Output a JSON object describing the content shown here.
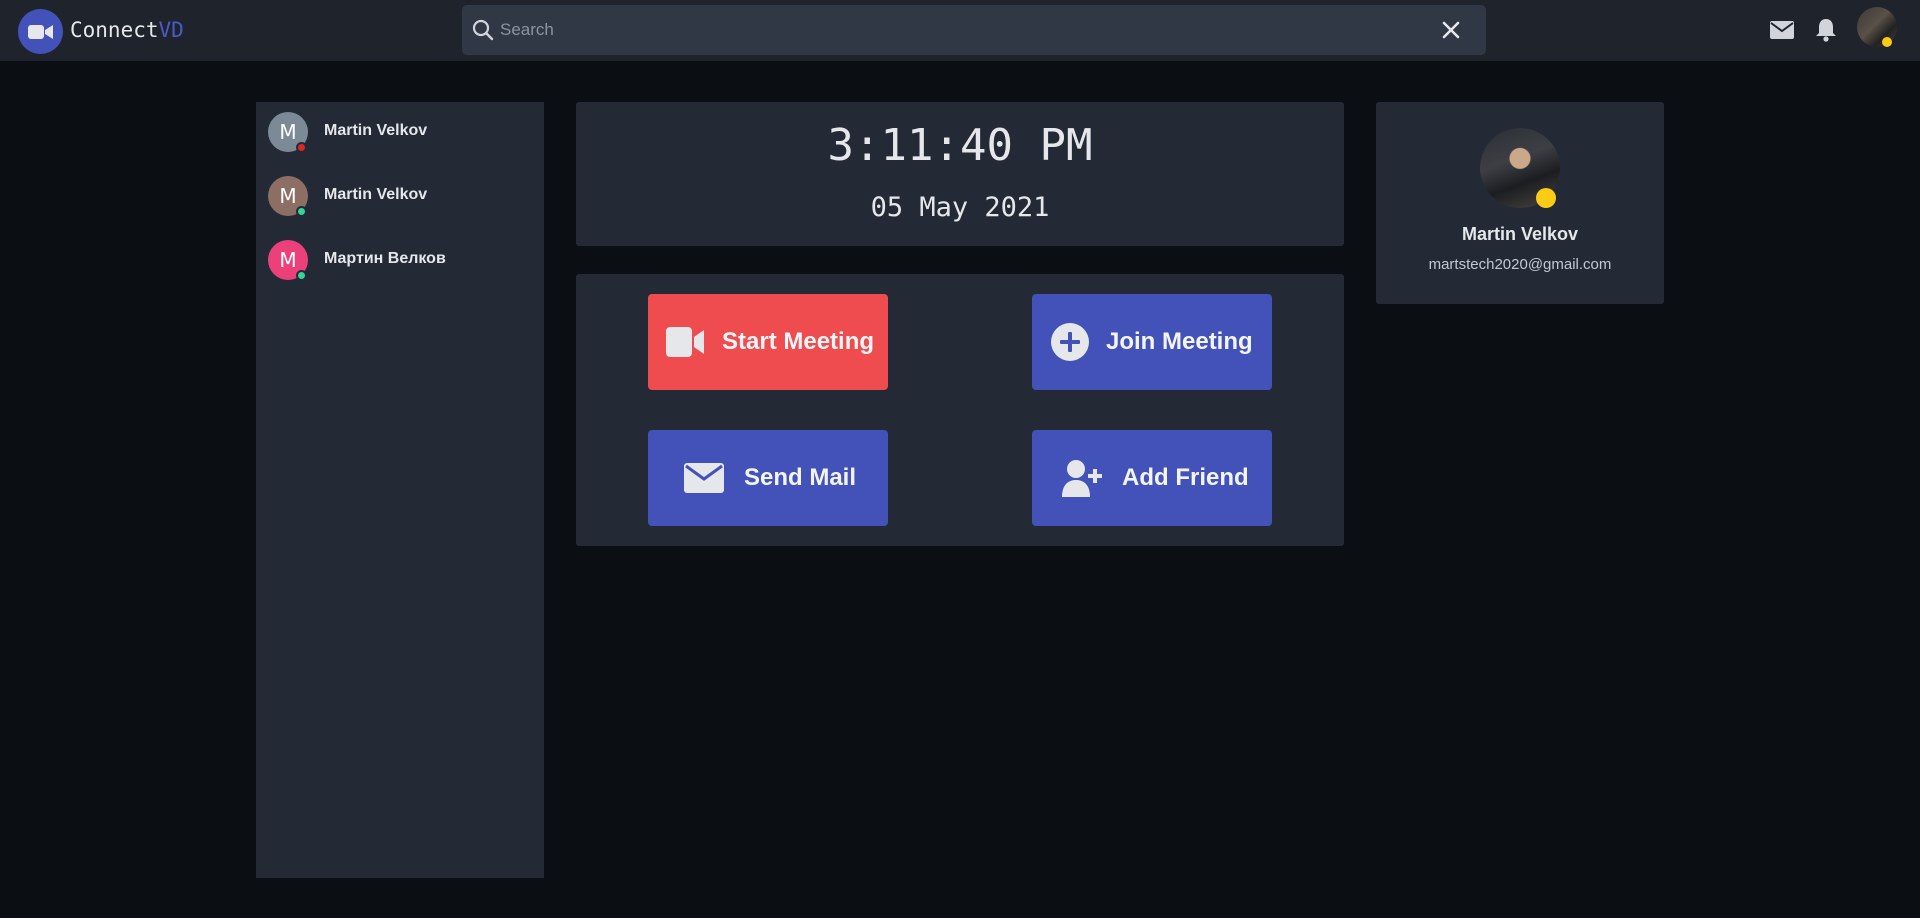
{
  "header": {
    "brand_main": "Connect",
    "brand_accent": "VD",
    "search_placeholder": "Search",
    "search_value": ""
  },
  "sidebar": {
    "contacts": [
      {
        "initial": "M",
        "name": "Martin Velkov",
        "avatar_color": "#7b8a96",
        "status_color": "#dc2626"
      },
      {
        "initial": "M",
        "name": "Martin Velkov",
        "avatar_color": "#8d6e63",
        "status_color": "#34d399"
      },
      {
        "initial": "M",
        "name": "Мартин Велков",
        "avatar_color": "#ec407a",
        "status_color": "#34d399"
      }
    ]
  },
  "clock": {
    "time": "3:11:40 PM",
    "date": "05 May 2021"
  },
  "actions": {
    "start_meeting": "Start Meeting",
    "join_meeting": "Join Meeting",
    "send_mail": "Send Mail",
    "add_friend": "Add Friend"
  },
  "profile": {
    "name": "Martin Velkov",
    "email": "martstech2020@gmail.com",
    "status_color": "#facc15"
  },
  "colors": {
    "accent": "#4352b8",
    "danger": "#ef4c4f",
    "panel": "#232a36",
    "background": "#0b0e12"
  },
  "icons": [
    "video-camera-icon",
    "search-icon",
    "close-icon",
    "mail-icon",
    "bell-icon",
    "plus-circle-icon",
    "user-plus-icon"
  ]
}
